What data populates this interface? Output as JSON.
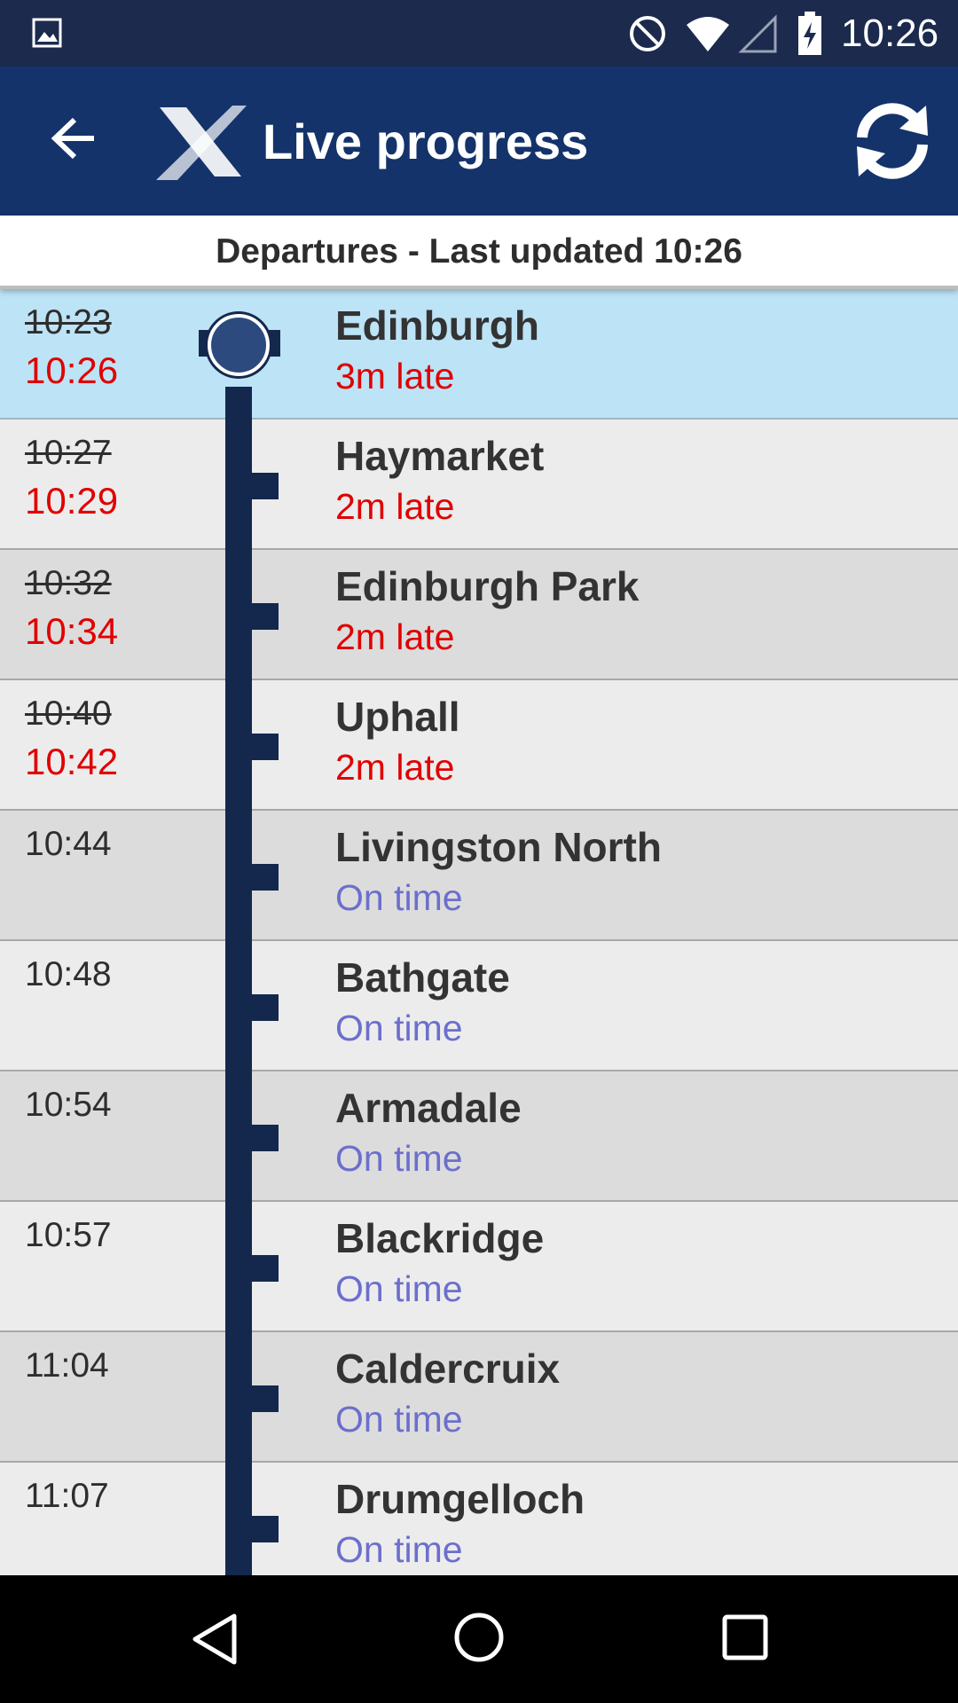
{
  "status_bar": {
    "time": "10:26",
    "icons": [
      "gallery-icon",
      "do-not-disturb-icon",
      "wifi-icon",
      "signal-icon",
      "battery-charging-icon"
    ]
  },
  "app_bar": {
    "title": "Live progress",
    "back_icon": "back-arrow-icon",
    "logo_icon": "brand-logo-icon",
    "refresh_icon": "refresh-icon"
  },
  "subheader": {
    "text": "Departures - Last updated 10:26"
  },
  "stops": [
    {
      "scheduled": "10:23",
      "expected": "10:26",
      "station": "Edinburgh",
      "status": "3m late",
      "late": true,
      "current": true
    },
    {
      "scheduled": "10:27",
      "expected": "10:29",
      "station": "Haymarket",
      "status": "2m late",
      "late": true
    },
    {
      "scheduled": "10:32",
      "expected": "10:34",
      "station": "Edinburgh Park",
      "status": "2m late",
      "late": true
    },
    {
      "scheduled": "10:40",
      "expected": "10:42",
      "station": "Uphall",
      "status": "2m late",
      "late": true
    },
    {
      "scheduled": "10:44",
      "station": "Livingston North",
      "status": "On time",
      "late": false
    },
    {
      "scheduled": "10:48",
      "station": "Bathgate",
      "status": "On time",
      "late": false
    },
    {
      "scheduled": "10:54",
      "station": "Armadale",
      "status": "On time",
      "late": false
    },
    {
      "scheduled": "10:57",
      "station": "Blackridge",
      "status": "On time",
      "late": false
    },
    {
      "scheduled": "11:04",
      "station": "Caldercruix",
      "status": "On time",
      "late": false
    },
    {
      "scheduled": "11:07",
      "station": "Drumgelloch",
      "status": "On time",
      "late": false
    }
  ],
  "colors": {
    "app_bar": "#14336b",
    "status_bar": "#1b2a4d",
    "current_row": "#bde3f6",
    "late": "#e00000",
    "on_time": "#6c6fcc",
    "track": "#14284e"
  },
  "nav_bar": {
    "icons": [
      "nav-back-icon",
      "nav-home-icon",
      "nav-recents-icon"
    ]
  }
}
